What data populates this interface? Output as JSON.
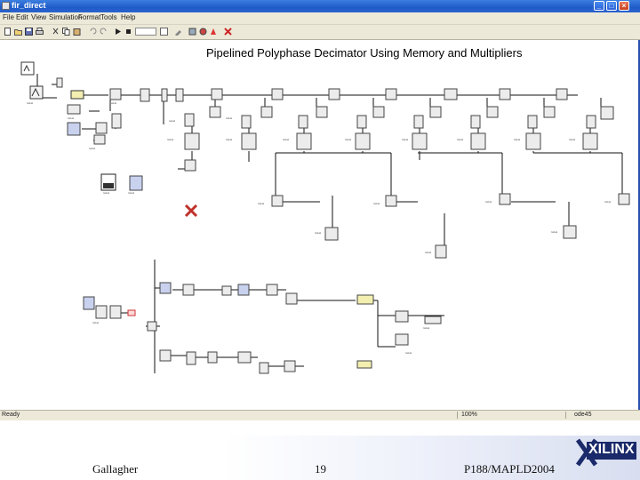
{
  "window": {
    "title": "fir_direct",
    "buttons": {
      "minimize": "_",
      "maximize": "□",
      "close": "×"
    }
  },
  "menu": [
    "File",
    "Edit",
    "View",
    "Simulation",
    "Format",
    "Tools",
    "Help"
  ],
  "toolbar_icons": [
    "new-icon",
    "open-icon",
    "save-icon",
    "print-icon",
    "cut-icon",
    "copy-icon",
    "paste-icon",
    "undo-icon",
    "redo-icon",
    "play-icon",
    "stop-icon",
    "normal-mode-icon",
    "build-icon",
    "library-icon",
    "explorer-icon",
    "debug-icon"
  ],
  "diagram": {
    "title": "Pipelined Polyphase Decimator Using Memory and Multipliers"
  },
  "status": {
    "left": "Ready",
    "zoom": "100%",
    "solver": "ode45"
  },
  "footer": {
    "author": "Gallagher",
    "page": "19",
    "ref": "P188/MAPLD2004"
  },
  "logo": {
    "text": "XILINX",
    "color": "#1a2a6a"
  }
}
